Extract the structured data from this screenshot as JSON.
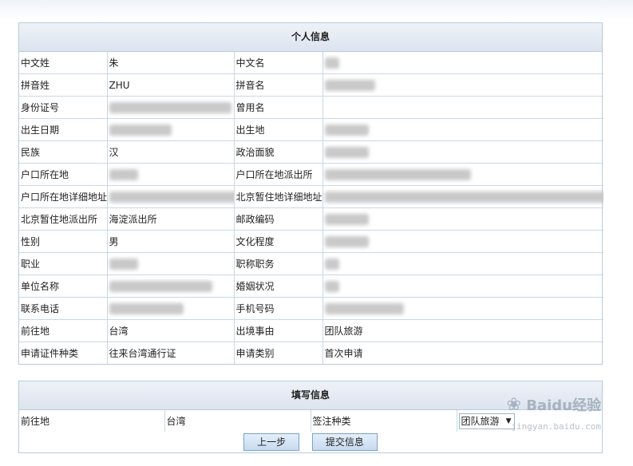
{
  "personal": {
    "header": "个人信息",
    "rows": [
      {
        "l1": "中文姓",
        "v1": "朱",
        "l2": "中文名",
        "v2": "██"
      },
      {
        "l1": "拼音姓",
        "v1": "ZHU",
        "l2": "拼音名",
        "v2": "S██████"
      },
      {
        "l1": "身份证号",
        "v1": "1███████████████2",
        "l2": "曾用名",
        "v2": ""
      },
      {
        "l1": "出生日期",
        "v1": "19██████2",
        "l2": "出生地",
        "v2": "██████"
      },
      {
        "l1": "民族",
        "v1": "汉",
        "l2": "政治面貌",
        "v2": "██████"
      },
      {
        "l1": "户口所在地",
        "v1": "████",
        "l2": "户口所在地派出所",
        "v2": "████████████████派出所"
      },
      {
        "l1": "户口所在地详细地址",
        "v1": "████████████████████",
        "l2": "北京暂住地详细地址",
        "v2": "海淀区空军北京苏州街██████████████（人大培院宿舍楼）"
      },
      {
        "l1": "北京暂住地派出所",
        "v1": "海淀派出所",
        "l2": "邮政编码",
        "v2": "██████"
      },
      {
        "l1": "性别",
        "v1": "男",
        "l2": "文化程度",
        "v2": "██████"
      },
      {
        "l1": "职业",
        "v1": "████",
        "l2": "职称职务",
        "v2": "██"
      },
      {
        "l1": "单位名称",
        "v1": "██████████████",
        "l2": "婚姻状况",
        "v2": "██"
      },
      {
        "l1": "联系电话",
        "v1": "1██████5762",
        "l2": "手机号码",
        "v2": "1██████████"
      },
      {
        "l1": "前往地",
        "v1": "台湾",
        "l2": "出境事由",
        "v2": "团队旅游"
      },
      {
        "l1": "申请证件种类",
        "v1": "往来台湾通行证",
        "l2": "申请类别",
        "v2": "首次申请"
      }
    ]
  },
  "fill": {
    "header": "填写信息",
    "dest_label": "前往地",
    "dest_value": "台湾",
    "visa_label": "签注种类",
    "visa_selected": "团队旅游"
  },
  "buttons": {
    "prev": "上一步",
    "submit": "提交信息"
  },
  "watermark": {
    "brand": "Baidu经验",
    "url": "jingyan.baidu.com"
  }
}
